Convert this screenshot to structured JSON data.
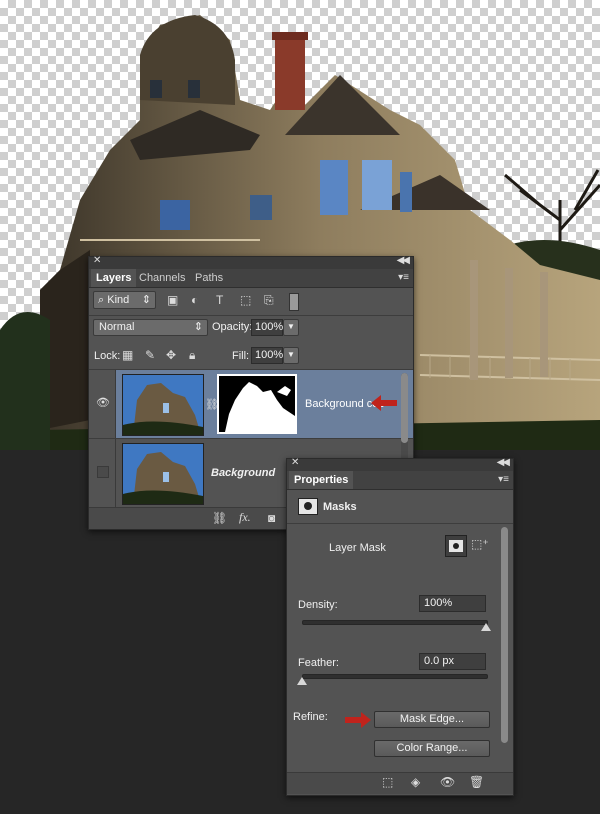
{
  "layers_panel": {
    "tabs": [
      {
        "label": "Layers"
      },
      {
        "label": "Channels"
      },
      {
        "label": "Paths"
      }
    ],
    "filter_kind": "Kind",
    "blend_mode": "Normal",
    "opacity_label": "Opacity:",
    "opacity_value": "100%",
    "lock_label": "Lock:",
    "fill_label": "Fill:",
    "fill_value": "100%",
    "layers": [
      {
        "name": "Background cop",
        "visible": true,
        "selected": true
      },
      {
        "name": "Background",
        "visible": false,
        "selected": false
      }
    ],
    "footer_icons": [
      "link-icon",
      "fx-icon",
      "mask-icon"
    ],
    "fx_label": "fx."
  },
  "properties_panel": {
    "tab": "Properties",
    "section": "Masks",
    "mask_type": "Layer Mask",
    "density_label": "Density:",
    "density_value": "100%",
    "density_level": 1.0,
    "feather_label": "Feather:",
    "feather_value": "0.0 px",
    "feather_level": 0.0,
    "refine_label": "Refine:",
    "mask_edge_button": "Mask Edge...",
    "color_range_button": "Color Range...",
    "footer_icons": [
      "selection-icon",
      "apply-mask-icon",
      "visibility-icon",
      "trash-icon"
    ]
  },
  "colors": {
    "annotation_arrow": "#c0231c",
    "selected_layer": "#6b7f9c",
    "panel_bg": "#535353"
  }
}
